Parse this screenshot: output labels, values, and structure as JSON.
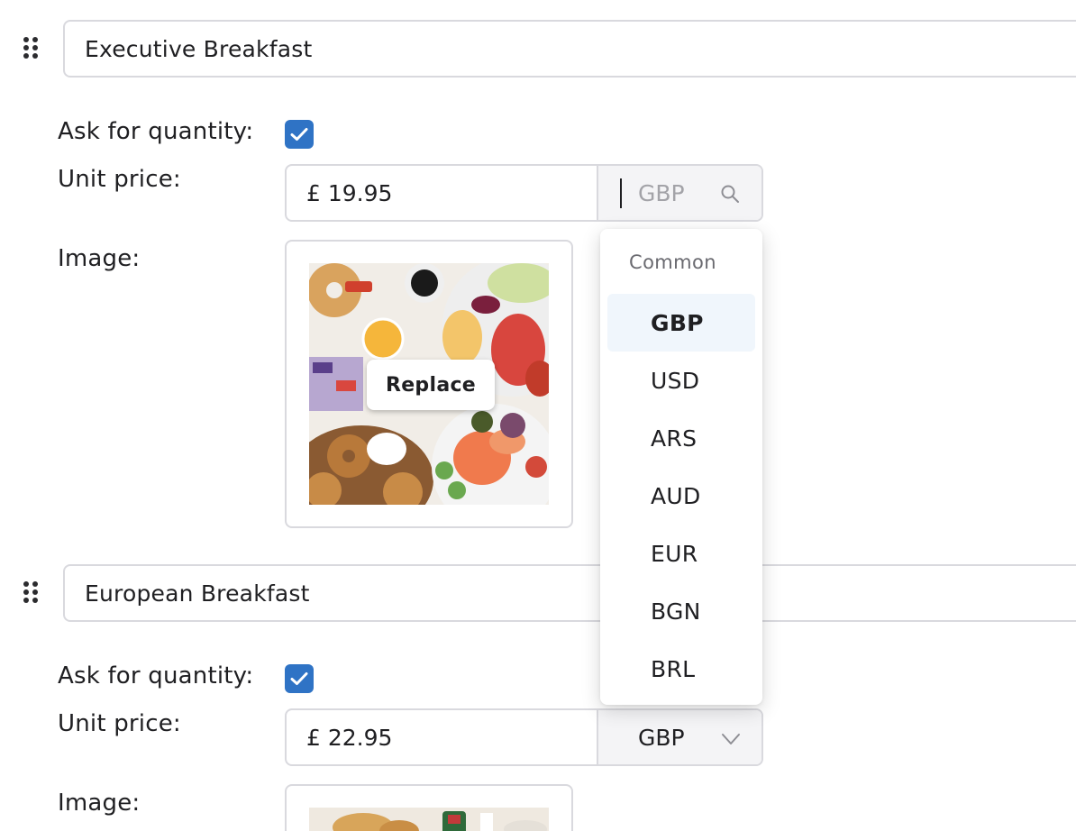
{
  "items": [
    {
      "name": "Executive Breakfast",
      "ask_quantity_label": "Ask for quantity:",
      "ask_quantity_checked": true,
      "unit_price_label": "Unit price:",
      "unit_price_value": "£ 19.95",
      "currency_placeholder": "GBP",
      "image_label": "Image:",
      "replace_label": "Replace"
    },
    {
      "name": "European Breakfast",
      "ask_quantity_label": "Ask for quantity:",
      "ask_quantity_checked": true,
      "unit_price_label": "Unit price:",
      "unit_price_value": "£ 22.95",
      "currency_value": "GBP",
      "image_label": "Image:"
    }
  ],
  "currency_dropdown": {
    "group_header": "Common",
    "options": [
      "GBP",
      "USD",
      "ARS",
      "AUD",
      "EUR",
      "BGN",
      "BRL"
    ],
    "highlighted": "GBP"
  },
  "icons": {
    "drag": "drag-handle-icon",
    "check": "checkmark-icon",
    "search": "search-icon",
    "chevron": "chevron-down-icon"
  },
  "colors": {
    "checkbox": "#2f73c5",
    "border": "#d9d9de",
    "currency_bg": "#f4f4f6",
    "highlight": "#f0f6fc"
  }
}
